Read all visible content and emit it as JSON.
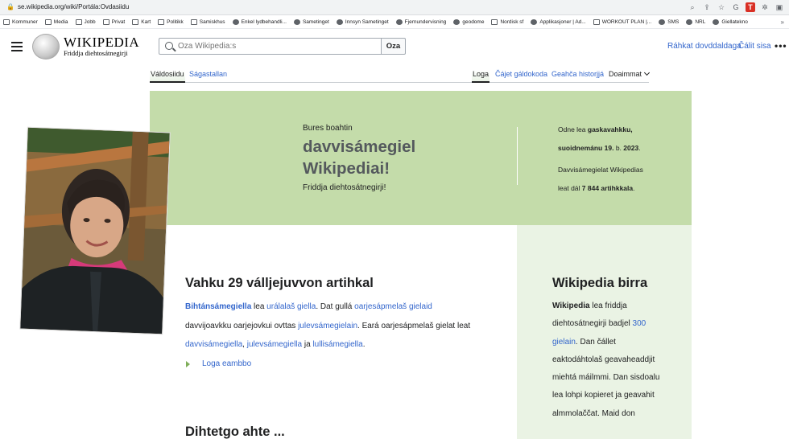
{
  "browser": {
    "url": "se.wikipedia.org/wiki/Portála:Ovdasiidu",
    "bookmarks": [
      "Kommuner",
      "Media",
      "Jobb",
      "Privat",
      "Kart",
      "Politikk",
      "Samiskhus",
      "Enkel lydbehandli...",
      "Sametinget",
      "Innsyn Sametinget",
      "Fjernundervisning",
      "geodome",
      "Nordisk sf",
      "Applikasjoner | Ad...",
      "WORKOUT PLAN |...",
      "SMS",
      "NRL",
      "Giellatekno"
    ],
    "bookmarks_more": "»"
  },
  "header": {
    "logo_word": "WIKIPEDIA",
    "logo_tagline": "Friddja diehtosátnegirji",
    "search_placeholder": "Oza Wikipedia:s",
    "search_button": "Oza",
    "create_account": "Ráhkat dovddaldaga",
    "login": "Čálit sisa",
    "more": "•••"
  },
  "tabs": {
    "page": "Váldosiidu",
    "talk": "Ságastallan",
    "read": "Loga",
    "view_source": "Čájet gáldokoda",
    "history": "Geahča historjjá",
    "tools": "Doaimmat"
  },
  "banner": {
    "pre": "Bures boahtin",
    "title": "davvisámegiel Wikipediai!",
    "subtitle": "Friddja diehtosátnegirji!",
    "today_prefix": "Odne lea",
    "today_bold": "gaskavahkku,",
    "date_bold": "suoidnemánu 19.",
    "date_mid": "b.",
    "date_year": "2023",
    "date_end": ".",
    "count_line1": "Davvisámegielat Wikipedias",
    "count_prefix": "leat dál",
    "count_bold": "7 844 artihkkala",
    "count_end": "."
  },
  "article": {
    "title": "Vahku 29 válljejuvvon artihkal",
    "link_bihtan": "Bihtánsámegiella",
    "t1": " lea ",
    "link_uralalas": "urálalaš giella",
    "t2": ". Dat gullá ",
    "link_oarjesap": "oarjesápmelaš gielaid",
    "t3": " davvijoavkku oarjejovkui ovttas ",
    "link_julev1": "julevsámegielain",
    "t4": ". Eará oarjesápmelaš gielat leat ",
    "link_davvi": "davvisámegiella",
    "t5": ", ",
    "link_julev2": "julevsámegiella",
    "t6": " ja ",
    "link_lulli": "lullisámegiella",
    "t7": ".",
    "more": "Loga eambbo",
    "next_section": "Dihtetgo ahte ..."
  },
  "about": {
    "title": "Wikipedia birra",
    "bold": "Wikipedia",
    "t1": " lea friddja diehtosátnegirji badjel ",
    "link_langs": "300 gielain",
    "t2": ". Dan čállet eaktodáhtolaš geava­headdjit miehtá máilmmi. Dan sisdoalu lea lohpi kopieret ja geavahit almmolaččat. Maid don"
  },
  "colors": {
    "banner": "#c4dcaa",
    "panel": "#eaf3e4",
    "link": "#3366cc"
  }
}
